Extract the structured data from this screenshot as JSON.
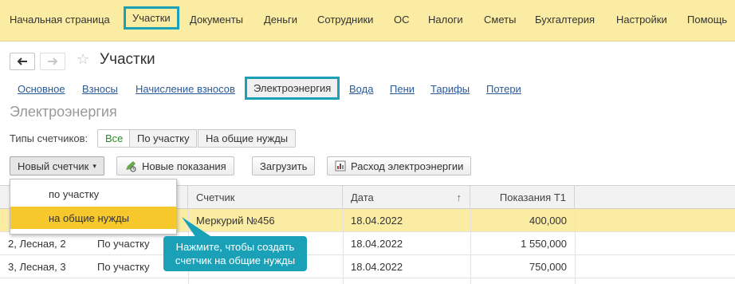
{
  "menu": {
    "items": [
      {
        "label": "Начальная страница",
        "active": false
      },
      {
        "label": "Участки",
        "active": true
      },
      {
        "label": "Документы",
        "active": false
      },
      {
        "label": "Деньги",
        "active": false
      },
      {
        "label": "Сотрудники",
        "active": false
      },
      {
        "label": "ОС",
        "active": false
      },
      {
        "label": "Налоги",
        "active": false
      },
      {
        "label": "Сметы",
        "active": false
      },
      {
        "label": "Бухгалтерия",
        "active": false
      },
      {
        "label": "Настройки",
        "active": false
      },
      {
        "label": "Помощь",
        "active": false
      }
    ]
  },
  "page": {
    "title": "Участки",
    "section_title": "Электроэнергия"
  },
  "tabs": [
    {
      "label": "Основное"
    },
    {
      "label": "Взносы"
    },
    {
      "label": "Начисление взносов"
    },
    {
      "label": "Электроэнергия",
      "active": true
    },
    {
      "label": "Вода"
    },
    {
      "label": "Пени"
    },
    {
      "label": "Тарифы"
    },
    {
      "label": "Потери"
    }
  ],
  "filter": {
    "label": "Типы счетчиков:",
    "options": [
      "Все",
      "По участку",
      "На общие нужды"
    ],
    "selected": "Все"
  },
  "toolbar": {
    "new_meter": "Новый счетчик",
    "new_readings": "Новые показания",
    "load": "Загрузить",
    "consumption": "Расход электроэнергии"
  },
  "dropdown": {
    "items": [
      "по участку",
      "на общие нужды"
    ],
    "selected": "на общие нужды"
  },
  "table": {
    "headers": {
      "meter": "Счетчик",
      "date": "Дата",
      "readings": "Показания Т1",
      "sort_indicator": "↑"
    },
    "rows": [
      {
        "plot": "",
        "type": "",
        "meter": "Меркурий №456",
        "date": "18.04.2022",
        "readings": "400,000",
        "selected": true
      },
      {
        "plot": "2, Лесная, 2",
        "type": "По участку",
        "meter": "",
        "date": "18.04.2022",
        "readings": "1 550,000"
      },
      {
        "plot": "3, Лесная, 3",
        "type": "По участку",
        "meter": "",
        "date": "18.04.2022",
        "readings": "750,000"
      }
    ]
  },
  "tooltip": {
    "text": "Нажмите, чтобы создать счетчик на общие нужды"
  },
  "colors": {
    "menu_bg": "#fbeca4",
    "highlight": "#1aa1b8",
    "selection": "#f7c82c",
    "link": "#2a5a9a"
  }
}
